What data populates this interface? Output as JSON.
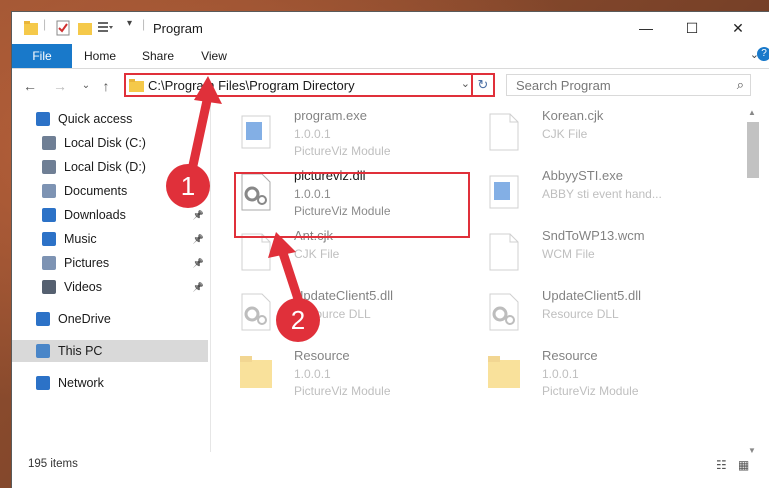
{
  "window": {
    "title": "Program",
    "colors": {
      "accent": "#1979ca",
      "highlight": "#e0303a"
    }
  },
  "ribbon": {
    "tabs": [
      "File",
      "Home",
      "Share",
      "View"
    ]
  },
  "address": {
    "path": "C:\\Program Files\\Program Directory",
    "search_placeholder": "Search Program"
  },
  "nav": {
    "items": [
      {
        "label": "Quick access",
        "icon": "star-icon",
        "pinned": false
      },
      {
        "label": "Local Disk (C:)",
        "icon": "drive-icon",
        "pinned": false
      },
      {
        "label": "Local Disk (D:)",
        "icon": "drive-icon",
        "pinned": false
      },
      {
        "label": "Documents",
        "icon": "documents-icon",
        "pinned": false
      },
      {
        "label": "Downloads",
        "icon": "download-icon",
        "pinned": true
      },
      {
        "label": "Music",
        "icon": "music-icon",
        "pinned": true
      },
      {
        "label": "Pictures",
        "icon": "pictures-icon",
        "pinned": true
      },
      {
        "label": "Videos",
        "icon": "video-icon",
        "pinned": true
      },
      {
        "label": "OneDrive",
        "icon": "cloud-icon",
        "pinned": false
      },
      {
        "label": "This PC",
        "icon": "computer-icon",
        "pinned": false,
        "selected": true
      },
      {
        "label": "Network",
        "icon": "network-icon",
        "pinned": false
      }
    ]
  },
  "files": [
    {
      "name": "program.exe",
      "line2": "1.0.0.1",
      "line3": "PictureViz Module",
      "icon": "exe-icon"
    },
    {
      "name": "Korean.cjk",
      "line2": "CJK File",
      "line3": "",
      "icon": "blank-file-icon"
    },
    {
      "name": "pictureviz.dll",
      "line2": "1.0.0.1",
      "line3": "PictureViz Module",
      "icon": "dll-gear-icon",
      "highlighted": true
    },
    {
      "name": "AbbyySTI.exe",
      "line2": "ABBY sti event hand...",
      "line3": "",
      "icon": "exe-icon"
    },
    {
      "name": "Ant.cjk",
      "line2": "CJK File",
      "line3": "",
      "icon": "blank-file-icon"
    },
    {
      "name": "SndToWP13.wcm",
      "line2": "WCM File",
      "line3": "",
      "icon": "blank-file-icon"
    },
    {
      "name": "UpdateClient5.dll",
      "line2": "Resource DLL",
      "line3": "",
      "icon": "dll-gear-icon"
    },
    {
      "name": "UpdateClient5.dll",
      "line2": "Resource DLL",
      "line3": "",
      "icon": "dll-gear-icon"
    },
    {
      "name": "Resource",
      "line2": "1.0.0.1",
      "line3": "PictureViz Module",
      "icon": "folder-icon"
    },
    {
      "name": "Resource",
      "line2": "1.0.0.1",
      "line3": "PictureViz Module",
      "icon": "folder-icon"
    }
  ],
  "status": {
    "items_count": "195 items"
  },
  "callouts": [
    "1",
    "2"
  ]
}
